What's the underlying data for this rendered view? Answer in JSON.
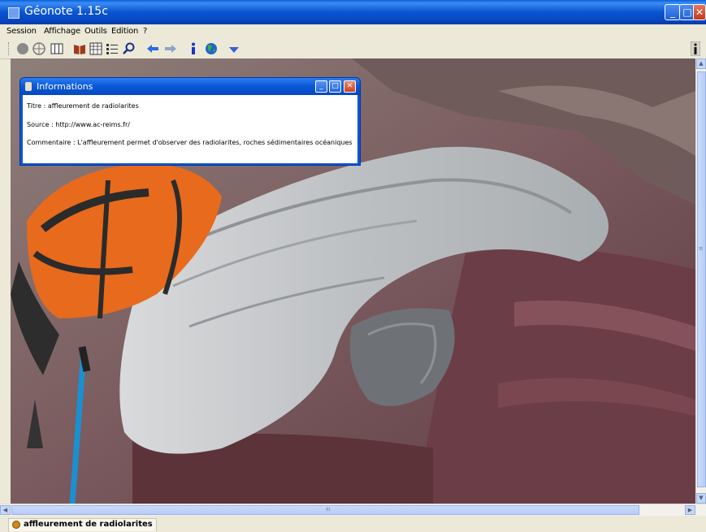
{
  "window": {
    "title": "Géonote 1.15c",
    "minimize": "_",
    "maximize": "□",
    "close": "✕"
  },
  "menu": [
    "Session",
    "Affichage",
    "Outils",
    "Edition",
    "?"
  ],
  "toolbar": {
    "icons": [
      "circle-grey-icon",
      "target-icon",
      "columns-icon",
      "book-icon",
      "grid-icon",
      "list-icon",
      "magnifier-icon",
      "arrow-left-icon",
      "arrow-right-icon",
      "info-icon",
      "globe-icon",
      "arrow-down-icon"
    ],
    "info_right": "i"
  },
  "dialog": {
    "title": "Informations",
    "titre": "Titre : affleurement de radiolarites",
    "source": "Source : http://www.ac-reims.fr/",
    "commentaire": "Commentaire : L'affleurement permet d'observer des radiolarites, roches sédimentaires océaniques"
  },
  "scrollbar": {
    "grip": "III",
    "grip_v": "≡"
  },
  "status": {
    "tab_label": "affleurement de radiolarites"
  },
  "colors": {
    "titlebar": "#0a55d0",
    "chrome": "#ece9d8",
    "accent": "#3b8cf5"
  }
}
